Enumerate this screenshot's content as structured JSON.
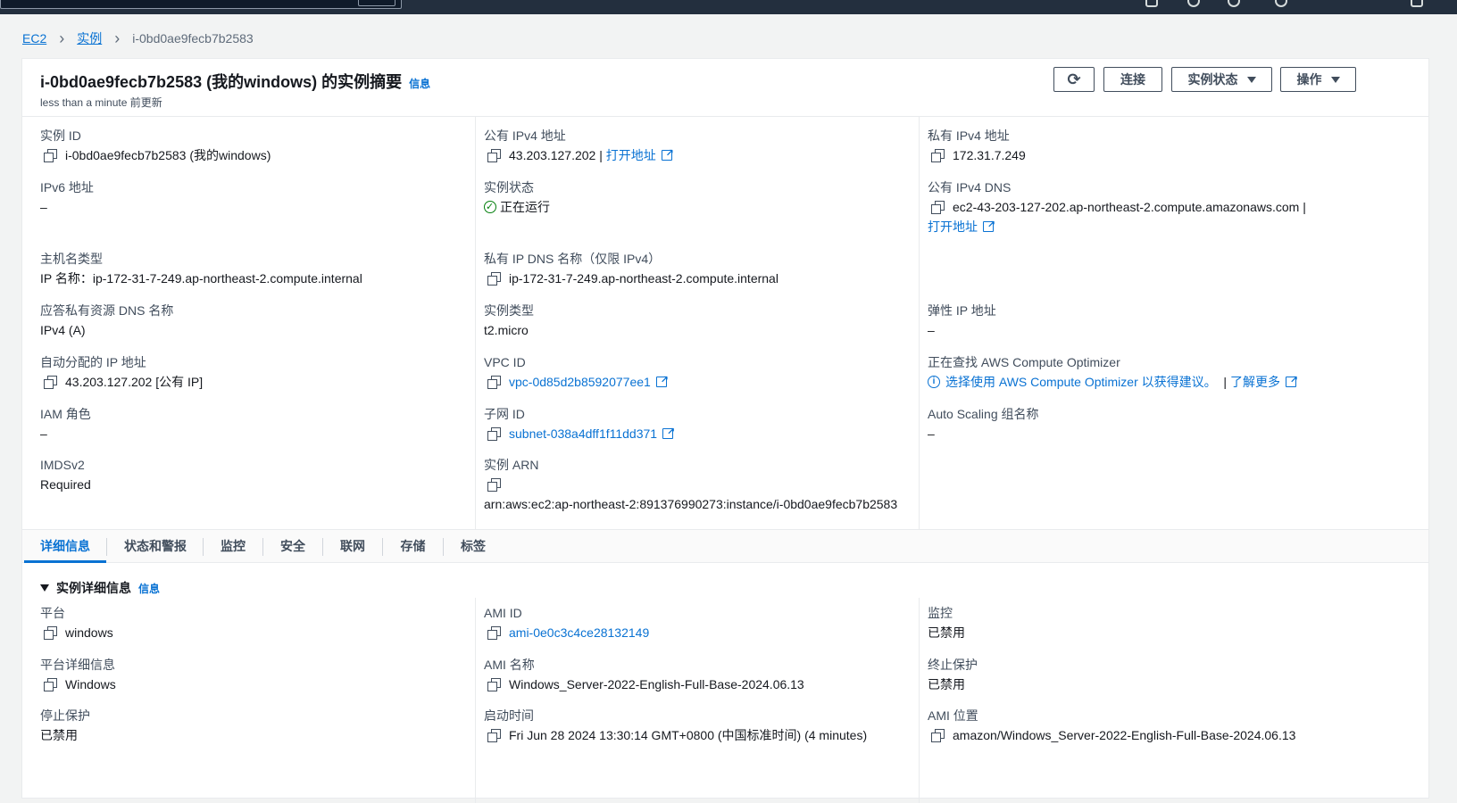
{
  "breadcrumb": {
    "ec2": "EC2",
    "instances": "实例",
    "current": "i-0bd0ae9fecb7b2583"
  },
  "header": {
    "title": "i-0bd0ae9fecb7b2583 (我的windows) 的实例摘要",
    "info": "信息",
    "updated": "less than a minute 前更新",
    "connect": "连接",
    "instance_state": "实例状态",
    "actions": "操作"
  },
  "summary": {
    "instance_id": {
      "label": "实例 ID",
      "value": "i-0bd0ae9fecb7b2583 (我的windows)"
    },
    "ipv6": {
      "label": "IPv6 地址",
      "value": "–"
    },
    "hostname_type": {
      "label": "主机名类型",
      "value": "IP 名称：ip-172-31-7-249.ap-northeast-2.compute.internal"
    },
    "answer_dns": {
      "label": "应答私有资源 DNS 名称",
      "value": "IPv4 (A)"
    },
    "auto_ip": {
      "label": "自动分配的 IP 地址",
      "value": "43.203.127.202 [公有 IP]"
    },
    "iam_role": {
      "label": "IAM 角色",
      "value": "–"
    },
    "imdsv2": {
      "label": "IMDSv2",
      "value": "Required"
    },
    "public_ipv4": {
      "label": "公有 IPv4 地址",
      "value": "43.203.127.202 |",
      "link": "打开地址"
    },
    "state": {
      "label": "实例状态",
      "value": "正在运行"
    },
    "private_dns": {
      "label": "私有 IP DNS 名称（仅限 IPv4）",
      "value": "ip-172-31-7-249.ap-northeast-2.compute.internal"
    },
    "instance_type": {
      "label": "实例类型",
      "value": "t2.micro"
    },
    "vpc": {
      "label": "VPC ID",
      "value": "vpc-0d85d2b8592077ee1"
    },
    "subnet": {
      "label": "子网 ID",
      "value": "subnet-038a4dff1f11dd371"
    },
    "arn": {
      "label": "实例 ARN",
      "value": "arn:aws:ec2:ap-northeast-2:891376990273:instance/i-0bd0ae9fecb7b2583"
    },
    "private_ipv4": {
      "label": "私有 IPv4 地址",
      "value": "172.31.7.249"
    },
    "public_dns": {
      "label": "公有 IPv4 DNS",
      "value": "ec2-43-203-127-202.ap-northeast-2.compute.amazonaws.com |",
      "link": "打开地址"
    },
    "elastic_ip": {
      "label": "弹性 IP 地址",
      "value": "–"
    },
    "optimizer": {
      "label": "正在查找 AWS Compute Optimizer",
      "value": "选择使用 AWS Compute Optimizer 以获得建议。",
      "sep": "|",
      "link": "了解更多"
    },
    "asg": {
      "label": "Auto Scaling 组名称",
      "value": "–"
    }
  },
  "tabs": [
    "详细信息",
    "状态和警报",
    "监控",
    "安全",
    "联网",
    "存储",
    "标签"
  ],
  "details": {
    "heading": "实例详细信息",
    "info": "信息",
    "platform": {
      "label": "平台",
      "value": "windows"
    },
    "platform_details": {
      "label": "平台详细信息",
      "value": "Windows"
    },
    "stop_protection": {
      "label": "停止保护",
      "value": "已禁用"
    },
    "ami_id": {
      "label": "AMI ID",
      "value": "ami-0e0c3c4ce28132149"
    },
    "ami_name": {
      "label": "AMI 名称",
      "value": "Windows_Server-2022-English-Full-Base-2024.06.13"
    },
    "launch_time": {
      "label": "启动时间",
      "value": "Fri Jun 28 2024 13:30:14 GMT+0800 (中国标准时间) (4 minutes)"
    },
    "monitoring": {
      "label": "监控",
      "value": "已禁用"
    },
    "termination_protection": {
      "label": "终止保护",
      "value": "已禁用"
    },
    "ami_location": {
      "label": "AMI 位置",
      "value": "amazon/Windows_Server-2022-English-Full-Base-2024.06.13"
    }
  }
}
